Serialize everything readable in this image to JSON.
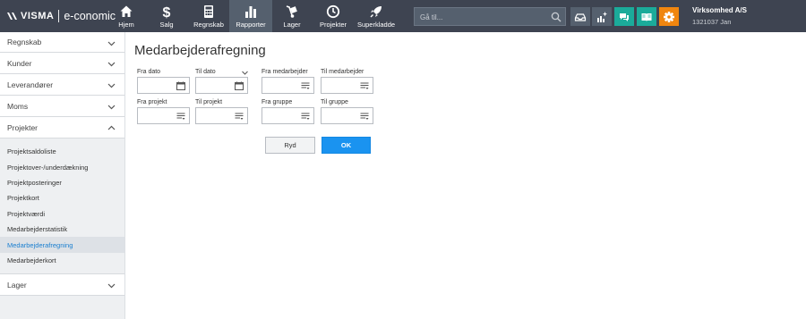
{
  "brand": {
    "visma": "VISMA",
    "product": "e-conomic"
  },
  "nav": [
    {
      "label": "Hjem",
      "icon": "home-icon"
    },
    {
      "label": "Salg",
      "icon": "dollar-icon"
    },
    {
      "label": "Regnskab",
      "icon": "calculator-icon"
    },
    {
      "label": "Rapporter",
      "icon": "bar-chart-icon",
      "active": true
    },
    {
      "label": "Lager",
      "icon": "dolly-icon"
    },
    {
      "label": "Projekter",
      "icon": "clock-icon"
    },
    {
      "label": "Superkladde",
      "icon": "rocket-icon"
    }
  ],
  "search": {
    "placeholder": "Gå til..."
  },
  "company": {
    "name": "Virksomhed A/S",
    "user": "1321037 Jan"
  },
  "colors": {
    "topbar": "#3e4451",
    "teal": "#1bab9a",
    "orange": "#f0860f",
    "blue": "#1a93f0"
  },
  "sidebar": {
    "sections": [
      "Regnskab",
      "Kunder",
      "Leverandører",
      "Moms",
      "Projekter",
      "Lager"
    ],
    "projekter_items": [
      "Projektsaldoliste",
      "Projektover-/underdækning",
      "Projektposteringer",
      "Projektkort",
      "Projektværdi",
      "Medarbejderstatistik",
      "Medarbejderafregning",
      "Medarbejderkort"
    ],
    "active_item": "Medarbejderafregning"
  },
  "page": {
    "title": "Medarbejderafregning",
    "fields": {
      "fra_dato": "Fra dato",
      "til_dato": "Til dato",
      "fra_medarbejder": "Fra medarbejder",
      "til_medarbejder": "Til medarbejder",
      "fra_projekt": "Fra projekt",
      "til_projekt": "Til projekt",
      "fra_gruppe": "Fra gruppe",
      "til_gruppe": "Til gruppe"
    },
    "buttons": {
      "ryd": "Ryd",
      "ok": "OK"
    }
  }
}
